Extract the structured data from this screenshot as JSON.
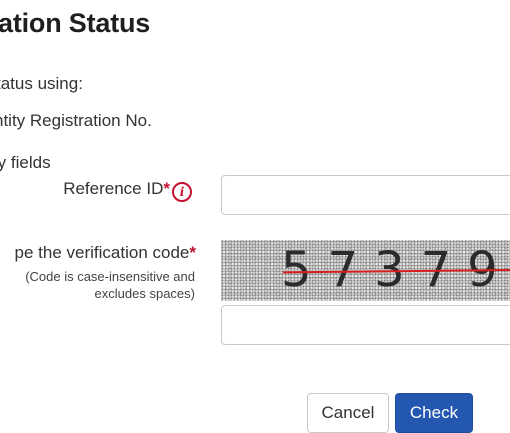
{
  "header": {
    "title": "ation Status"
  },
  "intro": {
    "line1": "tatus using:",
    "line2": "ntity Registration No.",
    "line3": "ry fields"
  },
  "form": {
    "reference_label": "Reference ID",
    "required_mark": "*",
    "info_glyph": "i",
    "verification_label": "pe the verification code",
    "verification_note": "(Code is case-insensitive and excludes spaces)",
    "captcha_code": "57379"
  },
  "buttons": {
    "cancel": "Cancel",
    "check": "Check"
  },
  "colors": {
    "required": "#c4122f",
    "primary": "#2458b0",
    "captcha_line": "#d61f1f"
  }
}
